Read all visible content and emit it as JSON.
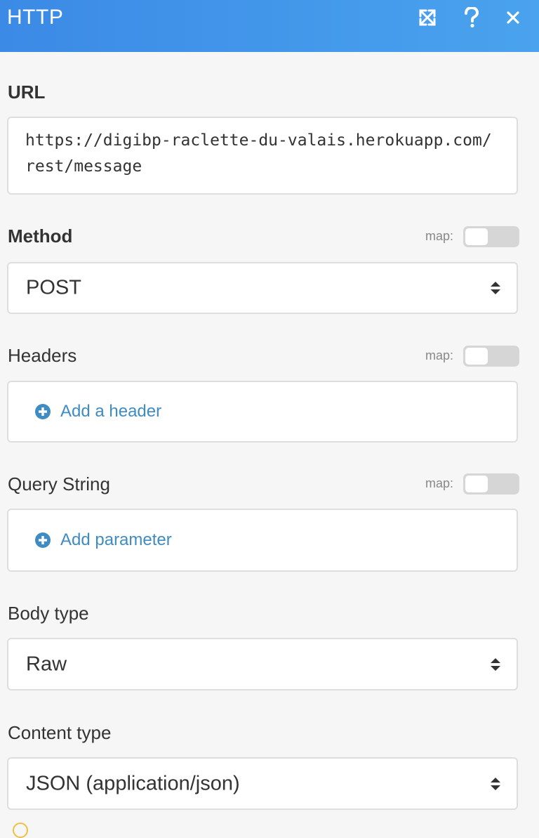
{
  "header": {
    "title": "HTTP",
    "icons": [
      "expand-icon",
      "help-icon",
      "close-icon"
    ]
  },
  "url": {
    "label": "URL",
    "value": "https://digibp-raclette-du-valais.herokuapp.com/rest/message"
  },
  "method": {
    "label": "Method",
    "map_label": "map:",
    "map_enabled": false,
    "value": "POST"
  },
  "headers": {
    "label": "Headers",
    "map_label": "map:",
    "map_enabled": false,
    "add_label": "Add a header"
  },
  "query_string": {
    "label": "Query String",
    "map_label": "map:",
    "map_enabled": false,
    "add_label": "Add parameter"
  },
  "body_type": {
    "label": "Body type",
    "value": "Raw"
  },
  "content_type": {
    "label": "Content type",
    "value": "JSON (application/json)"
  },
  "colors": {
    "header_start": "#3b8ae6",
    "header_end": "#4aa3ee",
    "link": "#3f8bc4",
    "background": "#f6f6f6"
  }
}
